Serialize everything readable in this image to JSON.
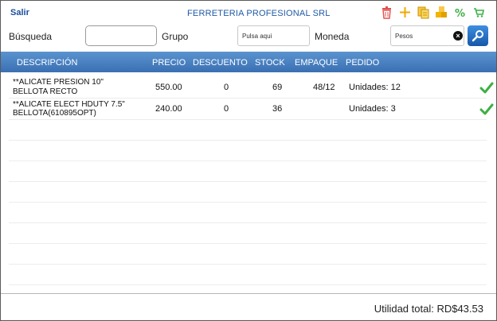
{
  "header": {
    "exit_label": "Salir",
    "company": "FERRETERIA PROFESIONAL SRL",
    "icons": [
      "trash-icon",
      "add-icon",
      "documents-icon",
      "stack-icon",
      "percent-icon",
      "cart-icon"
    ]
  },
  "filters": {
    "busqueda_label": "Búsqueda",
    "busqueda_value": "",
    "grupo_label": "Grupo",
    "grupo_value": "Pulsa aqui",
    "moneda_label": "Moneda",
    "moneda_value": "Pesos"
  },
  "table": {
    "columns": [
      "DESCRIPCIÓN",
      "PRECIO",
      "DESCUENTO",
      "STOCK",
      "EMPAQUE",
      "PEDIDO"
    ],
    "rows": [
      {
        "desc_line1": "**ALICATE PRESION 10\"",
        "desc_line2": "BELLOTA RECTO",
        "precio": "550.00",
        "descuento": "0",
        "stock": "69",
        "empaque": "48/12",
        "pedido": "Unidades: 12",
        "checked": true
      },
      {
        "desc_line1": "**ALICATE ELECT HDUTY  7.5\"",
        "desc_line2": "BELLOTA(610895OPT)",
        "precio": "240.00",
        "descuento": "0",
        "stock": "36",
        "empaque": "",
        "pedido": "Unidades: 3",
        "checked": true
      }
    ]
  },
  "footer": {
    "total_label": "Utilidad total: RD$43.53"
  },
  "colors": {
    "header_bar": "#3a70b3",
    "link_blue": "#1a4d9c",
    "check_green": "#3cb043"
  }
}
